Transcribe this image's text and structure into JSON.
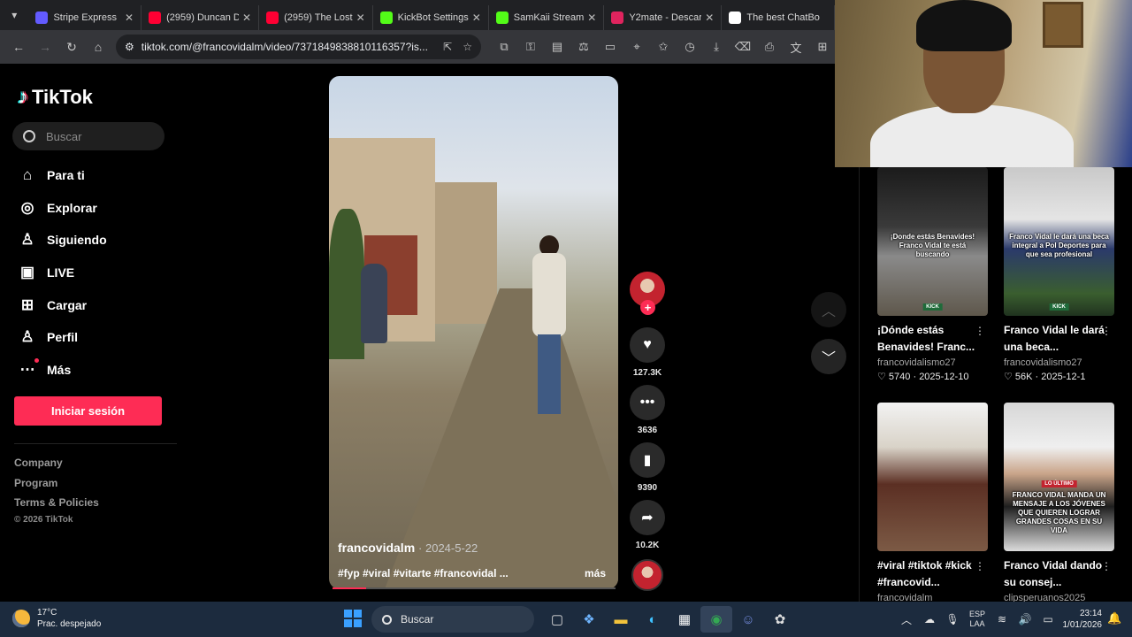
{
  "browser": {
    "tabs": [
      {
        "title": "Stripe Express",
        "color": "#635bff"
      },
      {
        "title": "(2959) Duncan D",
        "color": "#ff0033"
      },
      {
        "title": "(2959) The Lost",
        "color": "#ff0033"
      },
      {
        "title": "KickBot Settings",
        "color": "#53fc18"
      },
      {
        "title": "SamKaii Stream",
        "color": "#53fc18"
      },
      {
        "title": "Y2mate - Descar",
        "color": "#e0245e"
      },
      {
        "title": "The best ChatBo",
        "color": "#ffffff"
      }
    ],
    "url": "tiktok.com/@francovidalm/video/7371849838810116357?is..."
  },
  "sidebar": {
    "logo": "TikTok",
    "search_placeholder": "Buscar",
    "nav": [
      {
        "label": "Para ti",
        "icon": "home-icon"
      },
      {
        "label": "Explorar",
        "icon": "compass-icon"
      },
      {
        "label": "Siguiendo",
        "icon": "following-icon"
      },
      {
        "label": "LIVE",
        "icon": "live-icon"
      },
      {
        "label": "Cargar",
        "icon": "upload-icon"
      },
      {
        "label": "Perfil",
        "icon": "profile-icon"
      },
      {
        "label": "Más",
        "icon": "more-icon"
      }
    ],
    "login_label": "Iniciar sesión",
    "footer": [
      "Company",
      "Program",
      "Terms & Policies"
    ],
    "copyright": "© 2026 TikTok"
  },
  "video": {
    "username": "francovidalm",
    "date": "2024-5-22",
    "caption": "#fyp #viral #vitarte #francovidal ...",
    "more_label": "más",
    "progress": 0.12,
    "likes": "127.3K",
    "comments": "3636",
    "saves": "9390",
    "shares": "10.2K"
  },
  "related": [
    {
      "title": "¡Dónde estás Benavides! Franc...",
      "user": "francovidalismo27",
      "likes": "5740",
      "date": "2025-12-10",
      "overlay": "¡Donde estás Benavides! Franco Vidal te está buscando",
      "badge": "KICK"
    },
    {
      "title": "Franco Vidal le dará una beca...",
      "user": "francovidalismo27",
      "likes": "56K",
      "date": "2025-12-1",
      "overlay": "Franco Vidal le dará una beca integral a Pol Deportes para que sea profesional",
      "badge": "KICK"
    },
    {
      "title": "#viral #tiktok #kick #francovid...",
      "user": "francovidalm",
      "likes": "",
      "date": "",
      "overlay": "",
      "badge": ""
    },
    {
      "title": "Franco Vidal dando su consej...",
      "user": "clipsperuanos2025",
      "likes": "",
      "date": "",
      "overlay": "FRANCO VIDAL MANDA UN MENSAJE A LOS JÓVENES QUE QUIEREN LOGRAR GRANDES COSAS EN SU VIDA",
      "badge": "LO ÚLTIMO"
    }
  ],
  "taskbar": {
    "temperature": "17°C",
    "weather": "Prac. despejado",
    "search": "Buscar",
    "lang": [
      "ESP",
      "LAA"
    ],
    "time": "23:14",
    "date": "1/01/2026"
  }
}
